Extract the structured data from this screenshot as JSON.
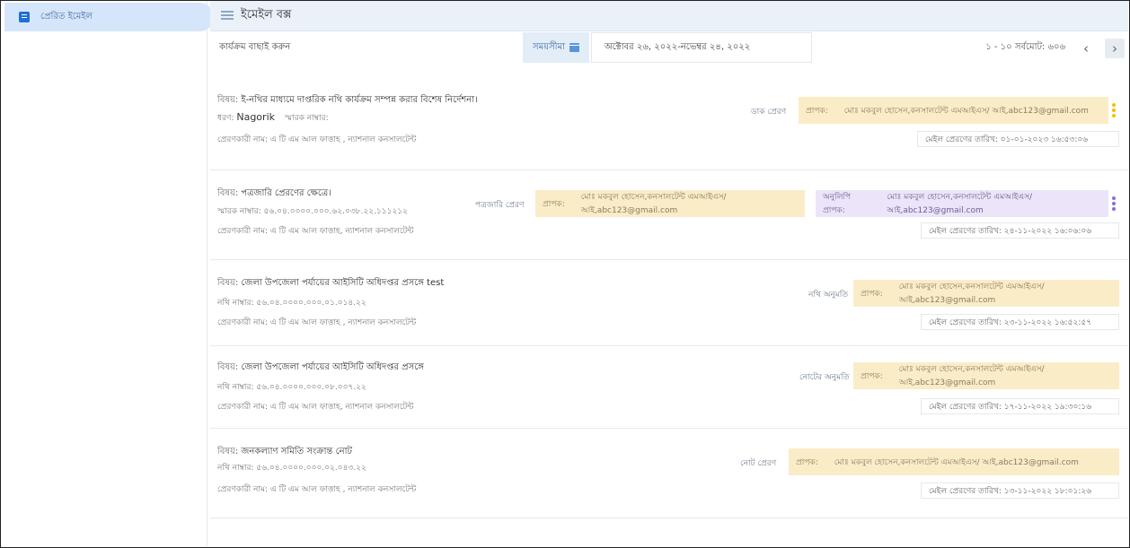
{
  "sidebar": {
    "items": [
      {
        "label": "প্রেরিত ইমেইল",
        "icon": "inbox-icon"
      }
    ]
  },
  "header": {
    "title": "ইমেইল বক্স"
  },
  "toolbar": {
    "select_label": "কার্যক্রম বাছাই করুন",
    "period_label": "সময়সীমা",
    "date_range": "অক্টোবর ২৬, ২০২২-নভেম্বর ২৪, ২০২২",
    "pagination": "১ - ১০ সর্বমোট: ৬০৬"
  },
  "emails": [
    {
      "subject_label": "বিষয়:",
      "subject": "ই-নথির মাধ্যমে দাপ্তরিক নথি কার্যক্রম সম্পন্ন করার বিশেষ নির্দেশনা।",
      "meta": "ধরণ: Nagorik   স্মারক নাম্বার:",
      "meta_type_label": "ধরণ:",
      "meta_type_value": "Nagorik",
      "meta_ref_label": "স্মারক নাম্বার:",
      "sender": "প্রেরণকারী নাম: এ টি এম আল ফাত্তাহ , ন্যাশনাল কনসালটেন্ট",
      "action": "ডাক প্রেরণ",
      "recipient_label": "প্রাপক:",
      "recipient": "মোঃ মকবুল হোসেন,কনসালটেন্ট এমআইএস/ আই,abc123@gmail.com",
      "date": "মেইল প্রেরণের তারিখ: ০১-০১-২০২৩ ১৬:৫৩:০৬"
    },
    {
      "subject_label": "বিষয়:",
      "subject": "পত্রজারি প্রেরণের ক্ষেত্রে।",
      "meta": "স্মারক নাম্বার: ৫৬.০৪.০০০০.০০০.৬২.০৩৮.২২.১১১২১২",
      "sender": "প্রেরণকারী নাম: এ টি এম আল ফাত্তাহ, ন্যাশনাল কনসালটেন্ট",
      "action": "পত্রজারি প্রেরণ",
      "recipient_label": "প্রাপক:",
      "recipient": "মোঃ মকবুল হোসেন,কনসালটেন্ট এমআইএস/ আই,abc123@gmail.com",
      "cc_label": "অনুলিপি প্রাপক:",
      "cc": "মোঃ মকবুল হোসেন,কনসালটেন্ট এমআইএস/ আই,abc123@gmail.com",
      "date": "মেইল প্রেরণের তারিখ: ২৪-১১-২০২২ ১৬:০৬:০৬"
    },
    {
      "subject_label": "বিষয়:",
      "subject": "জেলা উপজেলা পর্যায়ের আইসিটি অধিদপ্তর প্রসঙ্গে test",
      "meta": "নথি নাম্বার: ৫৬.০৪.০০০০.০০০.০১.০১৪.২২",
      "sender": "প্রেরণকারী নাম: এ টি এম আল ফাত্তাহ , ন্যাশনাল কনসালটেন্ট",
      "action": "নথি অনুমতি",
      "recipient_label": "প্রাপক:",
      "recipient": "মোঃ মকবুল হোসেন,কনসালটেন্ট এমআইএস/ আই,abc123@gmail.com",
      "date": "মেইল প্রেরণের তারিখ: ২৩-১১-২০২২ ১৬:৫২:৫৭"
    },
    {
      "subject_label": "বিষয়:",
      "subject": "জেলা উপজেলা পর্যায়ের আইসিটি অধিদপ্তর প্রসঙ্গে",
      "meta": "নথি নাম্বার: ৫৬.০৪.০০০০.০০০.০৮.০০৭.২২",
      "sender": "প্রেরণকারী নাম: এ টি এম আল ফাত্তাহ, ন্যাশনাল কনসালটেন্ট",
      "action": "নোটের অনুমতি",
      "recipient_label": "প্রাপক:",
      "recipient": "মোঃ মকবুল হোসেন,কনসালটেন্ট এমআইএস/ আই,abc123@gmail.com",
      "date": "মেইল প্রেরণের তারিখ: ১৭-১১-২০২২ ১৯:৩০:১৬"
    },
    {
      "subject_label": "বিষয়:",
      "subject": "জনকল্যাণ সমিতি সংক্রান্ত নোট",
      "meta": "নথি নাম্বার: ৫৬.০৪.০০০০.০০০.০২.০৪৩.২২",
      "sender": "প্রেরণকারী নাম: এ টি এম আল ফাত্তাহ , ন্যাশনাল কনসালটেন্ট",
      "action": "নোট প্রেরণ",
      "recipient_label": "প্রাপক:",
      "recipient": "মোঃ মকবুল হোসেন,কনসালটেন্ট এমআইএস/ আই,abc123@gmail.com",
      "date": "মেইল প্রেরণের তারিখ: ১৩-১১-২০২২ ১৮:০১:২৬"
    }
  ]
}
